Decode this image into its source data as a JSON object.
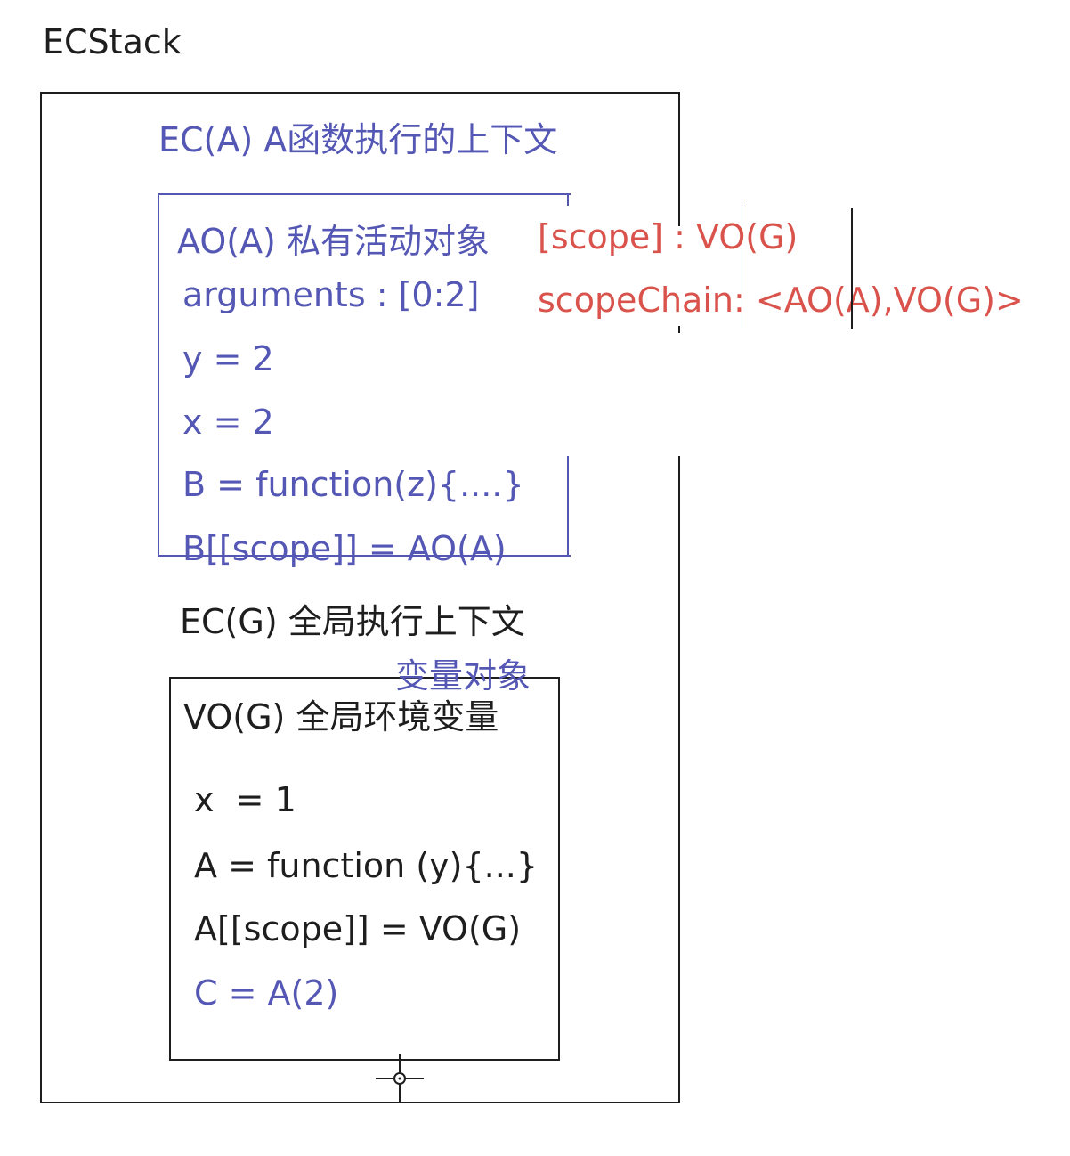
{
  "title": "ECStack",
  "ec_a": {
    "label": "EC(A) A函数执行的上下文",
    "ao": {
      "label": "AO(A) 私有活动对象",
      "lines": [
        "arguments : [0:2]",
        "y = 2",
        "x = 2",
        "B = function(z){....}",
        "B[[scope]] = AO(A)"
      ]
    },
    "scope": "[scope] : VO(G)",
    "scope_chain": "scopeChain: <AO(A),VO(G)>"
  },
  "ec_g": {
    "label": "EC(G) 全局执行上下文",
    "annotation": "变量对象",
    "vo": {
      "label": "VO(G) 全局环境变量",
      "lines": [
        "x  = 1",
        "A = function (y){...}",
        "A[[scope]] = VO(G)"
      ],
      "call_line": "C = A(2)"
    }
  },
  "colors": {
    "blue": "#5457b4",
    "black": "#1e1e1e",
    "red": "#d9534c",
    "background": "#ffffff"
  },
  "icons": {
    "cursor": "crosshair-move-cursor-icon"
  }
}
